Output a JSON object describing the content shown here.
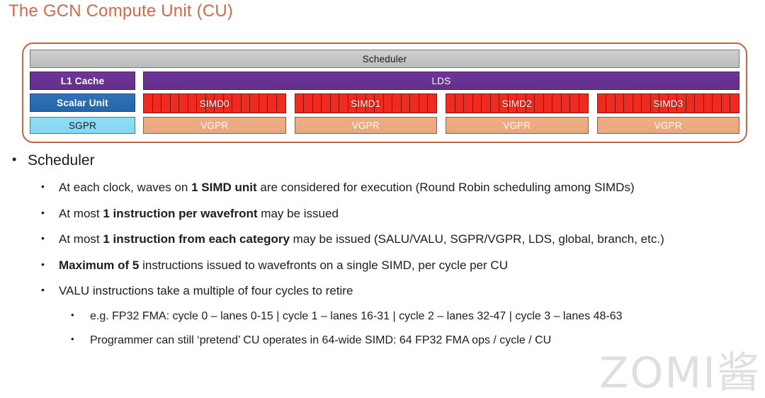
{
  "slide": {
    "title": "The GCN Compute Unit (CU)",
    "title_color": "#D2694B",
    "watermark": "ZOMI酱"
  },
  "diagram": {
    "border_color": "#C2663E",
    "scheduler": {
      "label": "Scheduler",
      "color": "#C6C6C6"
    },
    "left_column": [
      {
        "label": "L1 Cache",
        "color": "#6F3598"
      },
      {
        "label": "Scalar Unit",
        "color": "#2F72B8"
      },
      {
        "label": "SGPR",
        "color": "#8FDCF5"
      }
    ],
    "lds": {
      "label": "LDS",
      "color": "#6F3598"
    },
    "simd_color": "#EF2B20",
    "simd_segments": 16,
    "simds": [
      {
        "label": "SIMD0"
      },
      {
        "label": "SIMD1"
      },
      {
        "label": "SIMD2"
      },
      {
        "label": "SIMD3"
      }
    ],
    "vgpr_color": "#EFAD85",
    "vgprs": [
      {
        "label": "VGPR"
      },
      {
        "label": "VGPR"
      },
      {
        "label": "VGPR"
      },
      {
        "label": "VGPR"
      }
    ]
  },
  "bullets": {
    "marker": "•",
    "level1": {
      "text": "Scheduler"
    },
    "level2": [
      {
        "pre": "At each clock, waves on ",
        "bold": "1 SIMD unit",
        "post": " are considered for execution (Round Robin scheduling among SIMDs)"
      },
      {
        "pre": "At most ",
        "bold": "1 instruction per wavefront",
        "post": " may be issued"
      },
      {
        "pre": "At most ",
        "bold": "1 instruction from each category",
        "post": " may be issued (SALU/VALU, SGPR/VGPR, LDS, global, branch, etc.)"
      },
      {
        "pre": "",
        "bold": "Maximum of 5",
        "post": " instructions issued to wavefronts on a single SIMD, per cycle per CU"
      },
      {
        "pre": "VALU instructions take a multiple of four cycles to retire",
        "bold": "",
        "post": ""
      }
    ],
    "level3": [
      {
        "text": "e.g. FP32 FMA: cycle 0 – lanes 0-15 | cycle 1 – lanes 16-31 | cycle 2 – lanes 32-47 | cycle 3 – lanes 48-63"
      },
      {
        "text": "Programmer can still ‘pretend’ CU operates in 64-wide SIMD: 64 FP32 FMA ops / cycle / CU"
      }
    ]
  }
}
